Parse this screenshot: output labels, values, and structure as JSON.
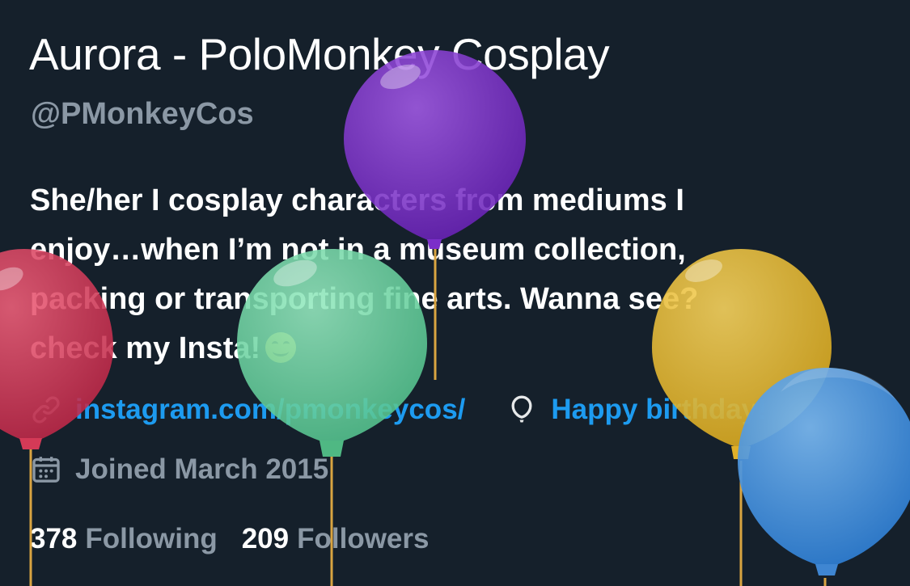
{
  "profile": {
    "display_name": "Aurora - PoloMonkey Cosplay",
    "handle": "@PMonkeyCos",
    "bio_lines": [
      "She/her I cosplay characters from mediums I",
      "enjoy…when I’m not in a museum collection,",
      "packing or transporting fine arts. Wanna see?",
      "check my Insta!"
    ],
    "bio_emoji": "smiling-face-emoji",
    "website": "instagram.com/pmonkeycos/",
    "birthday": "Happy birthday!",
    "joined": "Joined March 2015",
    "following_count": "378",
    "following_label": "Following",
    "followers_count": "209",
    "followers_label": "Followers"
  },
  "icons": {
    "link": "link-icon",
    "birthday": "balloon-icon",
    "calendar": "calendar-icon"
  },
  "balloons": [
    {
      "name": "purple-balloon",
      "color": "#7b2fc9"
    },
    {
      "name": "red-balloon",
      "color": "#d43a57"
    },
    {
      "name": "green-balloon",
      "color": "#6fd6a4"
    },
    {
      "name": "yellow-balloon",
      "color": "#e7bd3a"
    },
    {
      "name": "blue-balloon",
      "color": "#4a97e0"
    }
  ],
  "colors": {
    "background": "#15202b",
    "primary_text": "#ffffff",
    "secondary_text": "#8b98a5",
    "accent": "#1d9bf0"
  }
}
